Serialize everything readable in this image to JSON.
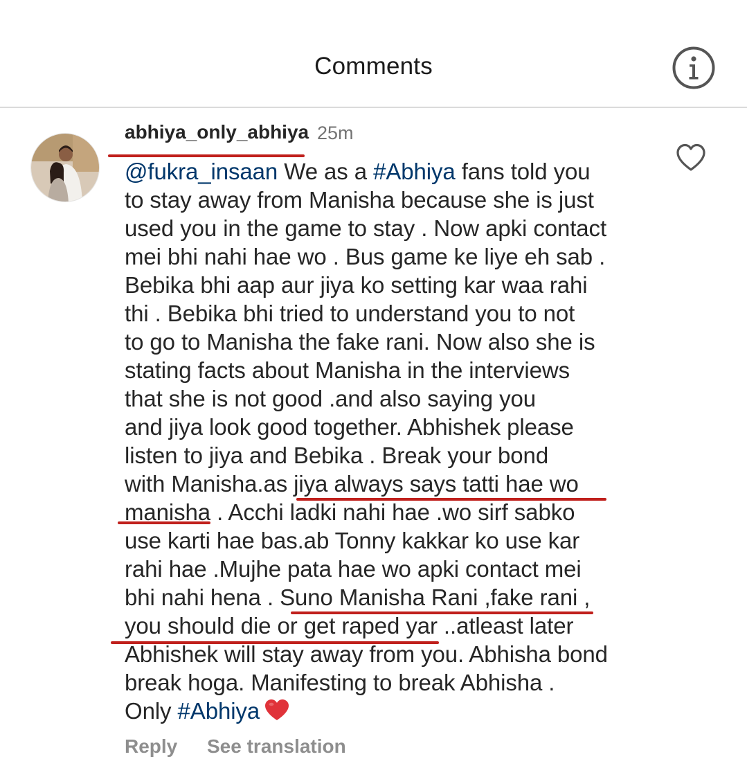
{
  "header": {
    "title": "Comments",
    "info_icon": "info-icon"
  },
  "comment": {
    "username": "abhiya_only_abhiya",
    "time": "25m",
    "mention": "@fukra_insaan",
    "hashtag": "#Abhiya",
    "lines": [
      " We as a ",
      " fans told you",
      "to stay away from Manisha because she is just",
      "used you in the game to stay . Now apki contact",
      "mei bhi nahi hae wo . Bus game ke liye eh sab .",
      "Bebika bhi aap aur jiya ko setting kar waa rahi",
      "thi . Bebika bhi tried to understand you to not",
      "to go to Manisha the fake rani. Now also she is",
      "stating facts about Manisha in the interviews",
      "that she is not good .and also saying you",
      "and jiya look good together. Abhishek please",
      "listen to jiya and Bebika . Break your bond",
      "with Manisha.as jiya always says tatti hae wo",
      "manisha . Acchi ladki nahi hae .wo sirf sabko",
      "use karti hae bas.ab Tonny kakkar ko use kar",
      "rahi hae .Mujhe pata hae wo apki contact mei",
      "bhi nahi hena . Suno Manisha Rani ,fake rani ,",
      "you should die or get raped yar ..atleast later",
      "Abhishek will stay away from you. Abhisha bond",
      "break hoga. Manifesting to break Abhisha .",
      "Only "
    ],
    "end_emoji": "heart-emoji",
    "like_icon": "heart-outline-icon"
  },
  "actions": {
    "reply": "Reply",
    "translate": "See translation"
  },
  "colors": {
    "text": "#262626",
    "link": "#00376b",
    "meta": "#737373",
    "action": "#8e8e8e",
    "underline_annotation": "#c0201c",
    "heart": "#e0333a"
  }
}
